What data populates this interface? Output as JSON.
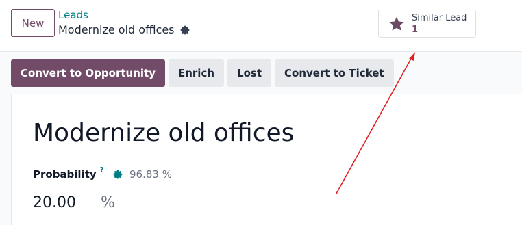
{
  "control_panel": {
    "new_label": "New",
    "breadcrumb": "Leads",
    "record_name": "Modernize old offices",
    "smart_button": {
      "label": "Similar Lead",
      "value": "1",
      "icon": "star-icon"
    }
  },
  "actions": {
    "convert_opportunity": "Convert to Opportunity",
    "enrich": "Enrich",
    "lost": "Lost",
    "convert_ticket": "Convert to Ticket"
  },
  "form": {
    "title": "Modernize old offices",
    "probability_label": "Probability",
    "tooltip_marker": "?",
    "automated_probability": "96.83 %",
    "probability_value": "20.00",
    "probability_unit": "%"
  },
  "colors": {
    "brand": "#714b67",
    "accent": "#017e84",
    "annotation": "#e02020"
  }
}
